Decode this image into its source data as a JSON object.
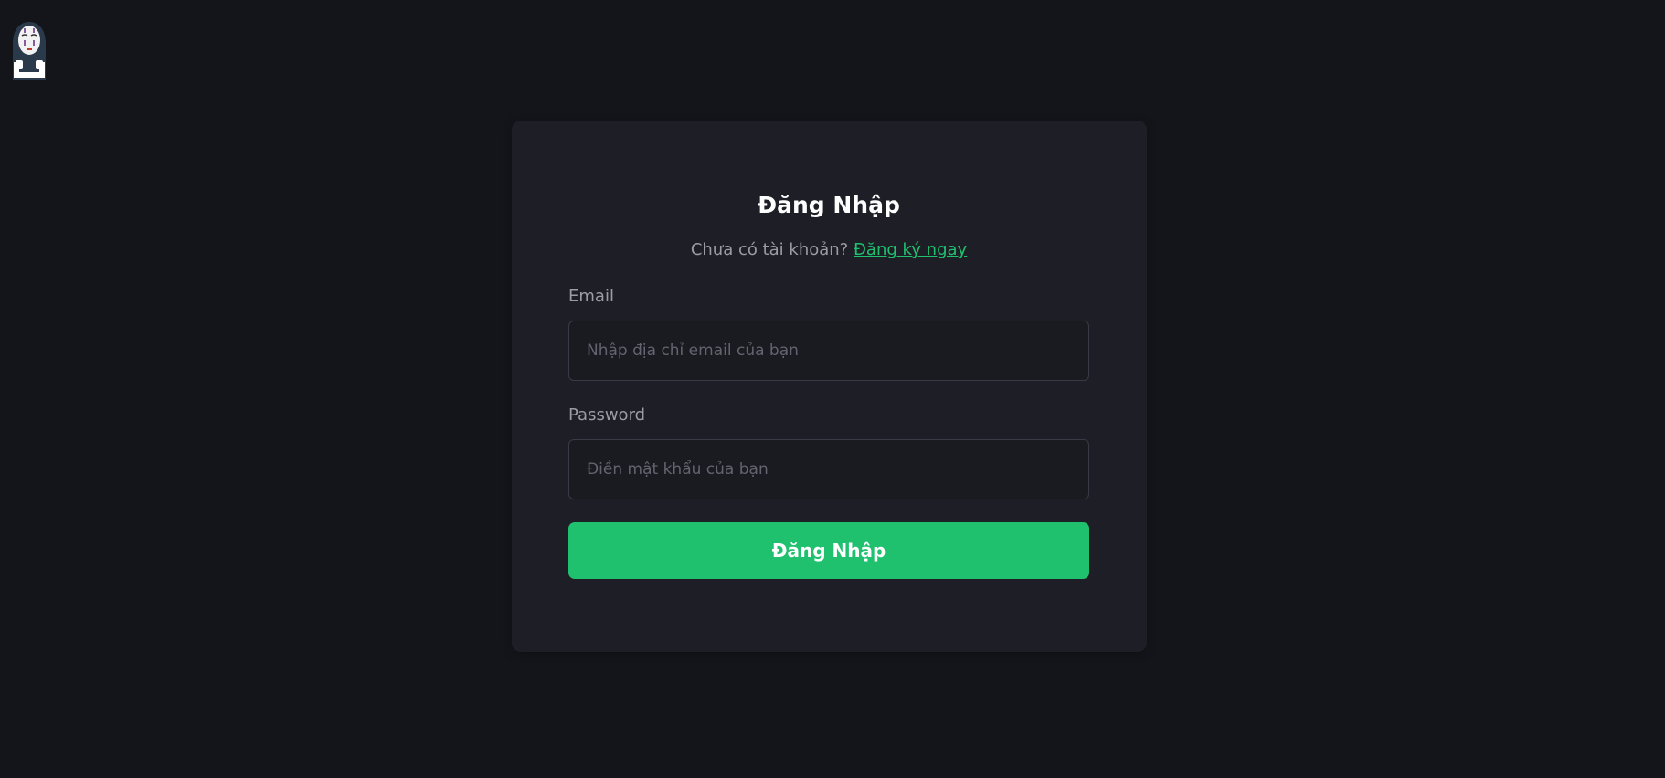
{
  "login": {
    "title": "Đăng Nhập",
    "prompt": "Chưa có tài khoản?",
    "register_link": "Đăng ký ngay",
    "email_label": "Email",
    "email_placeholder": "Nhập địa chỉ email của bạn",
    "email_value": "",
    "password_label": "Password",
    "password_placeholder": "Điền mật khẩu của bạn",
    "password_value": "",
    "submit_label": "Đăng Nhập"
  },
  "logo": {
    "icon": "no-face-mascot-icon"
  },
  "colors": {
    "background": "#14151a",
    "card": "#1e1f26",
    "accent": "#1fc16f",
    "muted_text": "#9a9ca6",
    "input_border": "#383a45"
  }
}
